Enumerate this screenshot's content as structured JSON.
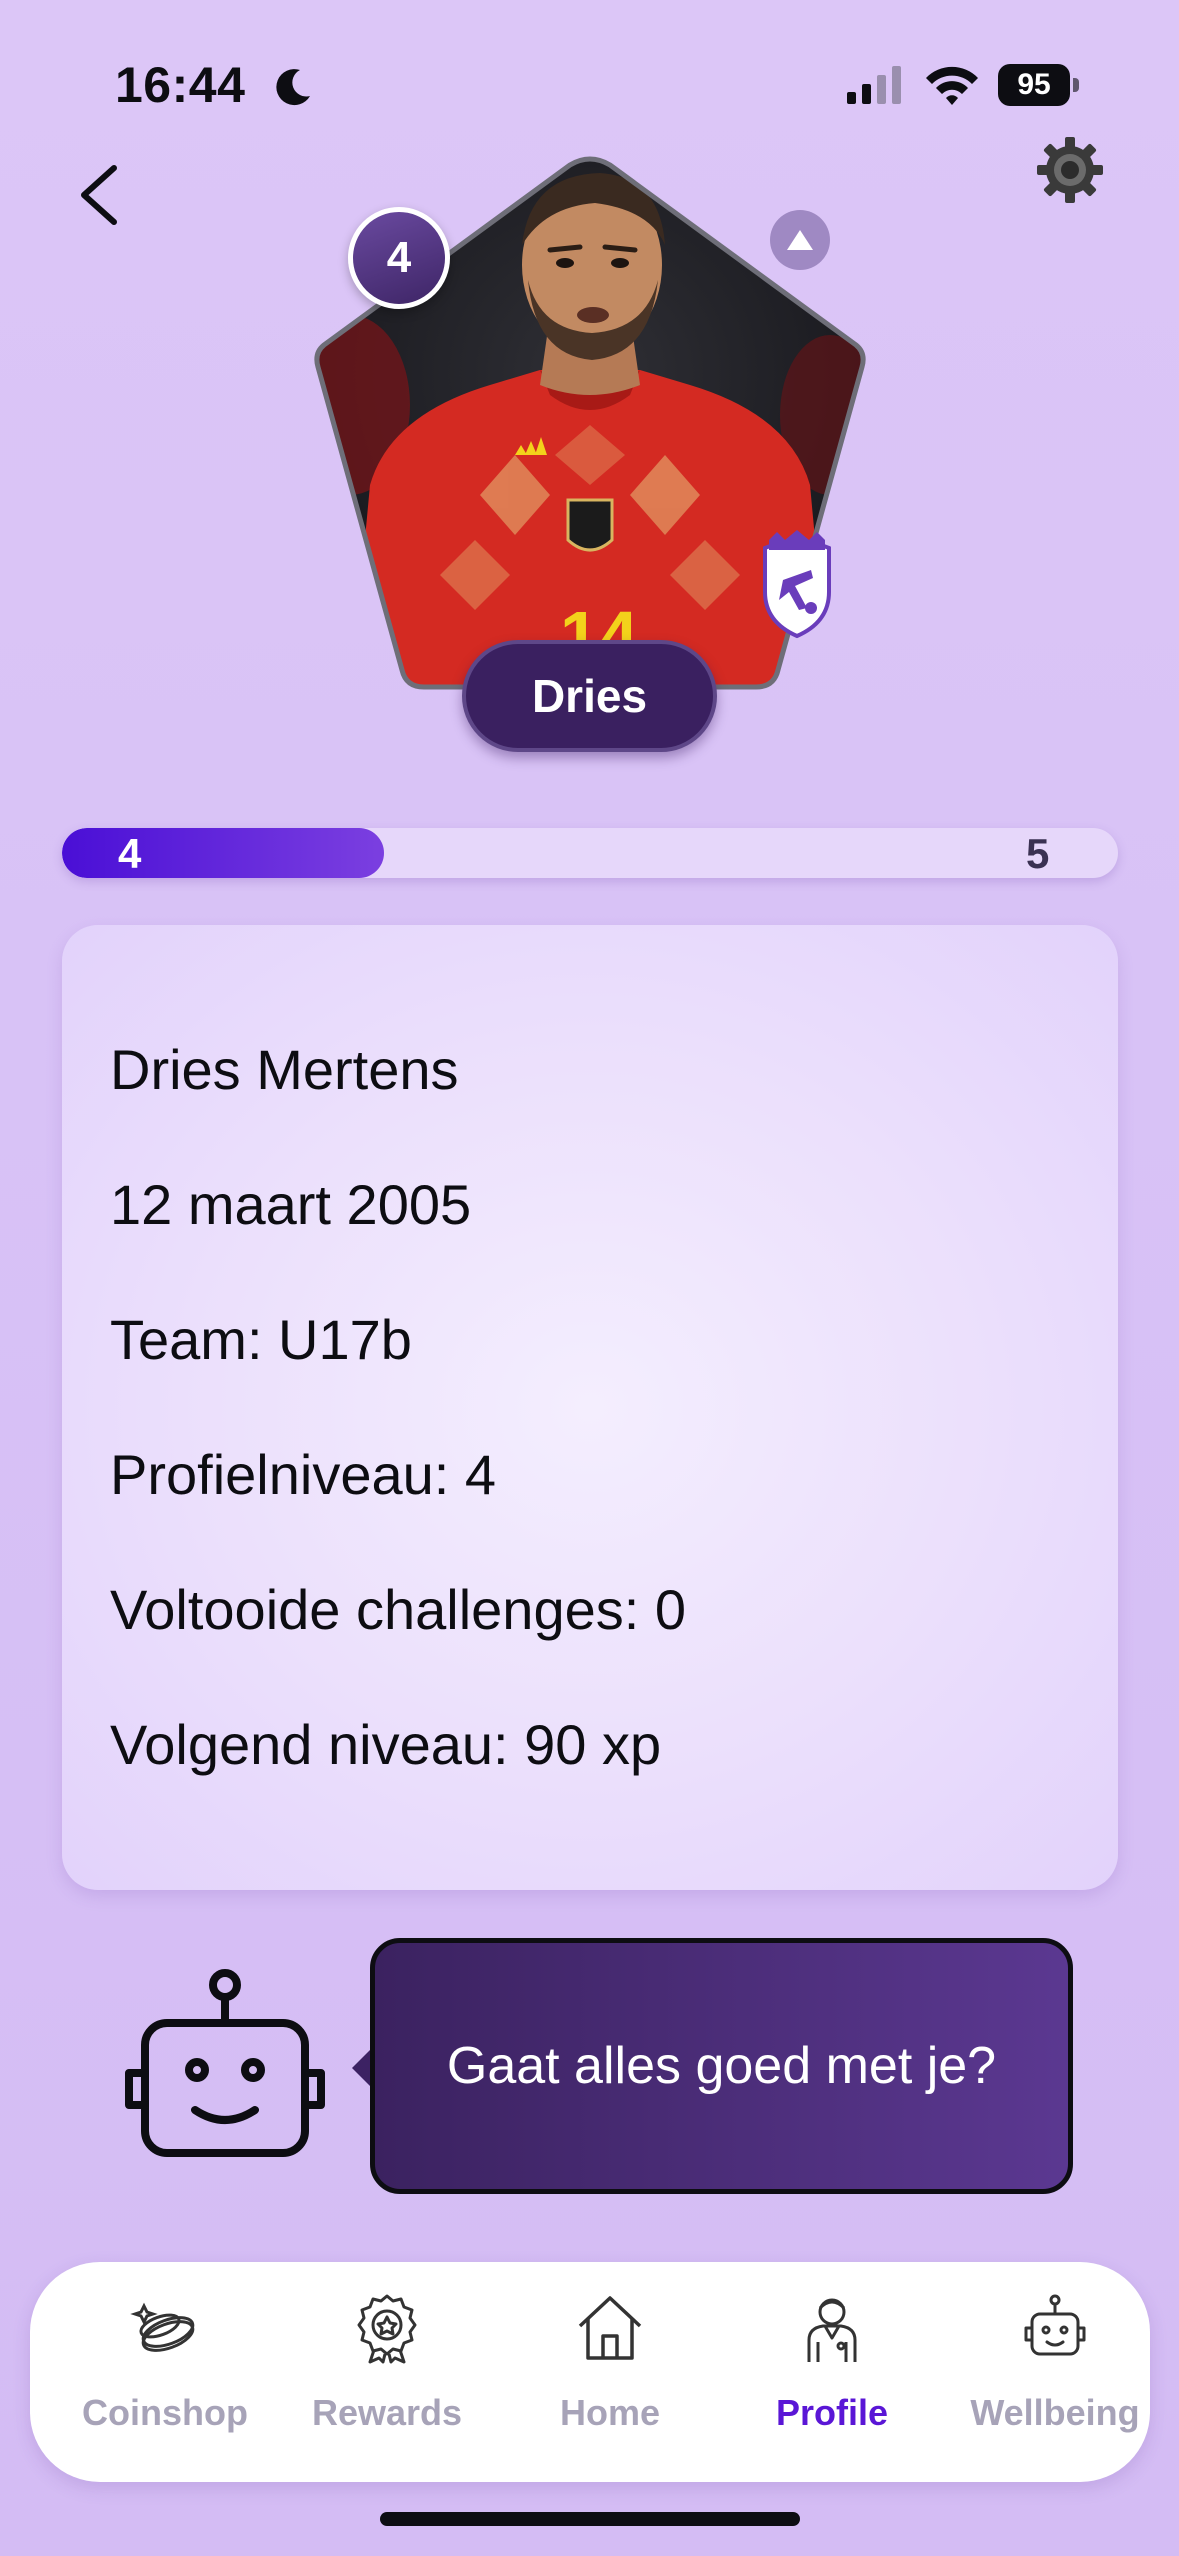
{
  "status_bar": {
    "time": "16:44",
    "battery": "95"
  },
  "avatar": {
    "level": "4",
    "name": "Dries"
  },
  "progress": {
    "current_level": "4",
    "next_level": "5",
    "fraction": 0.305
  },
  "info": {
    "full_name": "Dries Mertens",
    "birthdate": "12 maart 2005",
    "team": "Team: U17b",
    "profile_level": "Profielniveau: 4",
    "completed_challenges": "Voltooide challenges: 0",
    "next_level": "Volgend niveau: 90 xp"
  },
  "chat": {
    "message": "Gaat alles goed met je?"
  },
  "tabs": [
    {
      "label": "Coinshop",
      "icon": "coins-icon",
      "active": false
    },
    {
      "label": "Rewards",
      "icon": "medal-icon",
      "active": false
    },
    {
      "label": "Home",
      "icon": "home-icon",
      "active": false
    },
    {
      "label": "Profile",
      "icon": "player-icon",
      "active": true
    },
    {
      "label": "Wellbeing",
      "icon": "robot-icon",
      "active": false
    }
  ],
  "colors": {
    "accent": "#5a16d6",
    "bubble": "#3b2260",
    "background": "#dcc6f7"
  }
}
